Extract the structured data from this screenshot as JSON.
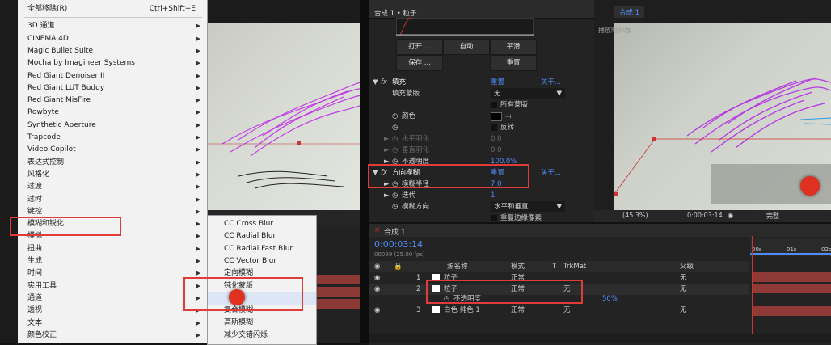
{
  "menu": {
    "items": [
      {
        "label": "全部移除(R)",
        "shortcut": "Ctrl+Shift+E",
        "submenu": false
      },
      {
        "label": "3D 通道",
        "submenu": true
      },
      {
        "label": "CINEMA 4D",
        "submenu": true
      },
      {
        "label": "Magic Bullet Suite",
        "submenu": true
      },
      {
        "label": "Mocha by Imagineer Systems",
        "submenu": true
      },
      {
        "label": "Red Giant Denoiser II",
        "submenu": true
      },
      {
        "label": "Red Giant LUT Buddy",
        "submenu": true
      },
      {
        "label": "Red Giant MisFire",
        "submenu": true
      },
      {
        "label": "Rowbyte",
        "submenu": true
      },
      {
        "label": "Synthetic Aperture",
        "submenu": true
      },
      {
        "label": "Trapcode",
        "submenu": true
      },
      {
        "label": "Video Copilot",
        "submenu": true
      },
      {
        "label": "表达式控制",
        "submenu": true
      },
      {
        "label": "风格化",
        "submenu": true
      },
      {
        "label": "过渡",
        "submenu": true
      },
      {
        "label": "过时",
        "submenu": true
      },
      {
        "label": "键控",
        "submenu": true
      },
      {
        "label": "模糊和锐化",
        "submenu": true
      },
      {
        "label": "模拟",
        "submenu": true
      },
      {
        "label": "扭曲",
        "submenu": true
      },
      {
        "label": "生成",
        "submenu": true
      },
      {
        "label": "时间",
        "submenu": true
      },
      {
        "label": "实用工具",
        "submenu": true
      },
      {
        "label": "通道",
        "submenu": true
      },
      {
        "label": "透视",
        "submenu": true
      },
      {
        "label": "文本",
        "submenu": true
      },
      {
        "label": "颜色校正",
        "submenu": true
      }
    ]
  },
  "submenu": {
    "items": [
      "CC Cross Blur",
      "CC Radial Blur",
      "CC Radial Fast Blur",
      "CC Vector Blur",
      "定向模糊",
      "钝化蒙版",
      "",
      "复合模糊",
      "高斯模糊",
      "减少交错闪烁"
    ]
  },
  "effects": {
    "tab_title": "合成 1 • 粒子",
    "buttons": {
      "open": "打开 ...",
      "auto": "自动",
      "smooth": "平滑",
      "save": "保存 ...",
      "reset": "重置"
    },
    "fill": {
      "name": "填充",
      "reset": "重置",
      "about": "关于...",
      "mask_label": "填充蒙版",
      "mask_value": "无",
      "all_masks": "所有蒙版",
      "color_label": "颜色",
      "invert": "反转",
      "h_feather": "水平羽化",
      "h_feather_val": "0.0",
      "v_feather": "垂直羽化",
      "v_feather_val": "0.0",
      "opacity": "不透明度",
      "opacity_val": "100.0%"
    },
    "blur": {
      "name": "方向模糊",
      "reset": "重置",
      "about": "关于...",
      "radius_label": "模糊半径",
      "radius_val": "7.0",
      "iter_label": "迭代",
      "iter_val": "1",
      "dir_label": "模糊方向",
      "dir_val": "水平和垂直",
      "repeat_edge": "重复边缘像素"
    }
  },
  "viewer": {
    "tab": "合成 1",
    "watermark": "播放时钟器",
    "zoom": "(45.3%)",
    "time": "0:00:03:14",
    "quality": "完整"
  },
  "timeline": {
    "tab": "合成 1",
    "timecode": "0:00:03:14",
    "fps": "00089 (25.00 fps)",
    "col_name": "源名称",
    "col_mode": "模式",
    "col_t": "T",
    "col_trkmat": "TrkMat",
    "col_parent": "父级",
    "layers": [
      {
        "num": "1",
        "name": "粒子",
        "mode": "正常",
        "trkmat": "",
        "parent": "无"
      },
      {
        "num": "2",
        "name": "粒子",
        "mode": "正常",
        "trkmat": "无",
        "parent": "无"
      },
      {
        "num": "3",
        "name": "白色 纯色 1",
        "mode": "正常",
        "trkmat": "无",
        "parent": "无"
      }
    ],
    "prop_label": "不透明度",
    "prop_value": "50%",
    "ruler": [
      "00s",
      "01s",
      "02s"
    ]
  },
  "colors": {
    "accent_red": "#e23b3b",
    "value_blue": "#4f8df5",
    "layer_bar": "#8f3a36"
  }
}
